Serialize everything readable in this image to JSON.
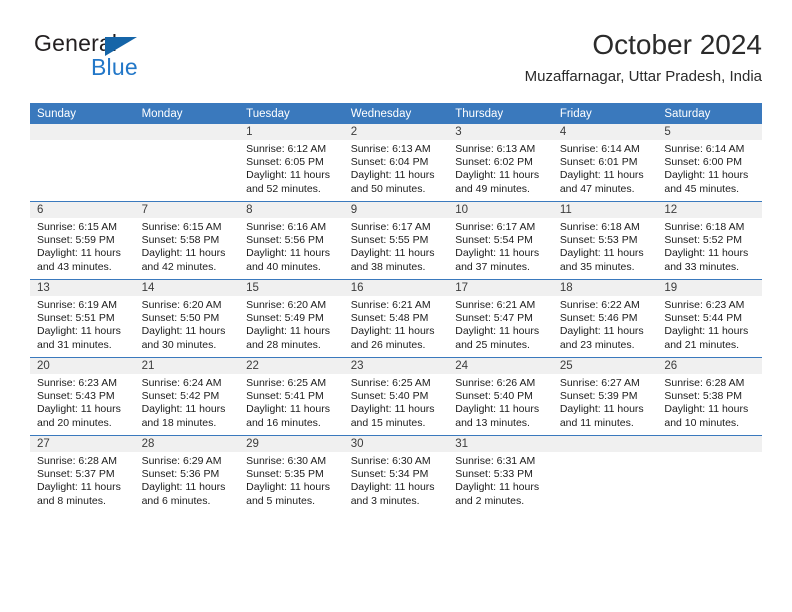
{
  "brand": {
    "name_top": "General",
    "name_bottom": "Blue",
    "triangle_icon": "blue-triangle-icon",
    "accent_color": "#2277c8"
  },
  "header": {
    "title": "October 2024",
    "subtitle": "Muzaffarnagar, Uttar Pradesh, India"
  },
  "theme": {
    "header_row_bg": "#3a79bd",
    "date_band_bg": "#f0f0f0",
    "separator_color": "#3a79bd",
    "text_color": "#1c1c1c"
  },
  "calendar": {
    "weekday_headers": [
      "Sunday",
      "Monday",
      "Tuesday",
      "Wednesday",
      "Thursday",
      "Friday",
      "Saturday"
    ],
    "weeks": [
      [
        {
          "date": "",
          "empty": true,
          "sunrise": "",
          "sunset": "",
          "daylight_line1": "",
          "daylight_line2": ""
        },
        {
          "date": "",
          "empty": true,
          "sunrise": "",
          "sunset": "",
          "daylight_line1": "",
          "daylight_line2": ""
        },
        {
          "date": "1",
          "empty": false,
          "sunrise": "Sunrise: 6:12 AM",
          "sunset": "Sunset: 6:05 PM",
          "daylight_line1": "Daylight: 11 hours",
          "daylight_line2": "and 52 minutes."
        },
        {
          "date": "2",
          "empty": false,
          "sunrise": "Sunrise: 6:13 AM",
          "sunset": "Sunset: 6:04 PM",
          "daylight_line1": "Daylight: 11 hours",
          "daylight_line2": "and 50 minutes."
        },
        {
          "date": "3",
          "empty": false,
          "sunrise": "Sunrise: 6:13 AM",
          "sunset": "Sunset: 6:02 PM",
          "daylight_line1": "Daylight: 11 hours",
          "daylight_line2": "and 49 minutes."
        },
        {
          "date": "4",
          "empty": false,
          "sunrise": "Sunrise: 6:14 AM",
          "sunset": "Sunset: 6:01 PM",
          "daylight_line1": "Daylight: 11 hours",
          "daylight_line2": "and 47 minutes."
        },
        {
          "date": "5",
          "empty": false,
          "sunrise": "Sunrise: 6:14 AM",
          "sunset": "Sunset: 6:00 PM",
          "daylight_line1": "Daylight: 11 hours",
          "daylight_line2": "and 45 minutes."
        }
      ],
      [
        {
          "date": "6",
          "empty": false,
          "sunrise": "Sunrise: 6:15 AM",
          "sunset": "Sunset: 5:59 PM",
          "daylight_line1": "Daylight: 11 hours",
          "daylight_line2": "and 43 minutes."
        },
        {
          "date": "7",
          "empty": false,
          "sunrise": "Sunrise: 6:15 AM",
          "sunset": "Sunset: 5:58 PM",
          "daylight_line1": "Daylight: 11 hours",
          "daylight_line2": "and 42 minutes."
        },
        {
          "date": "8",
          "empty": false,
          "sunrise": "Sunrise: 6:16 AM",
          "sunset": "Sunset: 5:56 PM",
          "daylight_line1": "Daylight: 11 hours",
          "daylight_line2": "and 40 minutes."
        },
        {
          "date": "9",
          "empty": false,
          "sunrise": "Sunrise: 6:17 AM",
          "sunset": "Sunset: 5:55 PM",
          "daylight_line1": "Daylight: 11 hours",
          "daylight_line2": "and 38 minutes."
        },
        {
          "date": "10",
          "empty": false,
          "sunrise": "Sunrise: 6:17 AM",
          "sunset": "Sunset: 5:54 PM",
          "daylight_line1": "Daylight: 11 hours",
          "daylight_line2": "and 37 minutes."
        },
        {
          "date": "11",
          "empty": false,
          "sunrise": "Sunrise: 6:18 AM",
          "sunset": "Sunset: 5:53 PM",
          "daylight_line1": "Daylight: 11 hours",
          "daylight_line2": "and 35 minutes."
        },
        {
          "date": "12",
          "empty": false,
          "sunrise": "Sunrise: 6:18 AM",
          "sunset": "Sunset: 5:52 PM",
          "daylight_line1": "Daylight: 11 hours",
          "daylight_line2": "and 33 minutes."
        }
      ],
      [
        {
          "date": "13",
          "empty": false,
          "sunrise": "Sunrise: 6:19 AM",
          "sunset": "Sunset: 5:51 PM",
          "daylight_line1": "Daylight: 11 hours",
          "daylight_line2": "and 31 minutes."
        },
        {
          "date": "14",
          "empty": false,
          "sunrise": "Sunrise: 6:20 AM",
          "sunset": "Sunset: 5:50 PM",
          "daylight_line1": "Daylight: 11 hours",
          "daylight_line2": "and 30 minutes."
        },
        {
          "date": "15",
          "empty": false,
          "sunrise": "Sunrise: 6:20 AM",
          "sunset": "Sunset: 5:49 PM",
          "daylight_line1": "Daylight: 11 hours",
          "daylight_line2": "and 28 minutes."
        },
        {
          "date": "16",
          "empty": false,
          "sunrise": "Sunrise: 6:21 AM",
          "sunset": "Sunset: 5:48 PM",
          "daylight_line1": "Daylight: 11 hours",
          "daylight_line2": "and 26 minutes."
        },
        {
          "date": "17",
          "empty": false,
          "sunrise": "Sunrise: 6:21 AM",
          "sunset": "Sunset: 5:47 PM",
          "daylight_line1": "Daylight: 11 hours",
          "daylight_line2": "and 25 minutes."
        },
        {
          "date": "18",
          "empty": false,
          "sunrise": "Sunrise: 6:22 AM",
          "sunset": "Sunset: 5:46 PM",
          "daylight_line1": "Daylight: 11 hours",
          "daylight_line2": "and 23 minutes."
        },
        {
          "date": "19",
          "empty": false,
          "sunrise": "Sunrise: 6:23 AM",
          "sunset": "Sunset: 5:44 PM",
          "daylight_line1": "Daylight: 11 hours",
          "daylight_line2": "and 21 minutes."
        }
      ],
      [
        {
          "date": "20",
          "empty": false,
          "sunrise": "Sunrise: 6:23 AM",
          "sunset": "Sunset: 5:43 PM",
          "daylight_line1": "Daylight: 11 hours",
          "daylight_line2": "and 20 minutes."
        },
        {
          "date": "21",
          "empty": false,
          "sunrise": "Sunrise: 6:24 AM",
          "sunset": "Sunset: 5:42 PM",
          "daylight_line1": "Daylight: 11 hours",
          "daylight_line2": "and 18 minutes."
        },
        {
          "date": "22",
          "empty": false,
          "sunrise": "Sunrise: 6:25 AM",
          "sunset": "Sunset: 5:41 PM",
          "daylight_line1": "Daylight: 11 hours",
          "daylight_line2": "and 16 minutes."
        },
        {
          "date": "23",
          "empty": false,
          "sunrise": "Sunrise: 6:25 AM",
          "sunset": "Sunset: 5:40 PM",
          "daylight_line1": "Daylight: 11 hours",
          "daylight_line2": "and 15 minutes."
        },
        {
          "date": "24",
          "empty": false,
          "sunrise": "Sunrise: 6:26 AM",
          "sunset": "Sunset: 5:40 PM",
          "daylight_line1": "Daylight: 11 hours",
          "daylight_line2": "and 13 minutes."
        },
        {
          "date": "25",
          "empty": false,
          "sunrise": "Sunrise: 6:27 AM",
          "sunset": "Sunset: 5:39 PM",
          "daylight_line1": "Daylight: 11 hours",
          "daylight_line2": "and 11 minutes."
        },
        {
          "date": "26",
          "empty": false,
          "sunrise": "Sunrise: 6:28 AM",
          "sunset": "Sunset: 5:38 PM",
          "daylight_line1": "Daylight: 11 hours",
          "daylight_line2": "and 10 minutes."
        }
      ],
      [
        {
          "date": "27",
          "empty": false,
          "sunrise": "Sunrise: 6:28 AM",
          "sunset": "Sunset: 5:37 PM",
          "daylight_line1": "Daylight: 11 hours",
          "daylight_line2": "and 8 minutes."
        },
        {
          "date": "28",
          "empty": false,
          "sunrise": "Sunrise: 6:29 AM",
          "sunset": "Sunset: 5:36 PM",
          "daylight_line1": "Daylight: 11 hours",
          "daylight_line2": "and 6 minutes."
        },
        {
          "date": "29",
          "empty": false,
          "sunrise": "Sunrise: 6:30 AM",
          "sunset": "Sunset: 5:35 PM",
          "daylight_line1": "Daylight: 11 hours",
          "daylight_line2": "and 5 minutes."
        },
        {
          "date": "30",
          "empty": false,
          "sunrise": "Sunrise: 6:30 AM",
          "sunset": "Sunset: 5:34 PM",
          "daylight_line1": "Daylight: 11 hours",
          "daylight_line2": "and 3 minutes."
        },
        {
          "date": "31",
          "empty": false,
          "sunrise": "Sunrise: 6:31 AM",
          "sunset": "Sunset: 5:33 PM",
          "daylight_line1": "Daylight: 11 hours",
          "daylight_line2": "and 2 minutes."
        },
        {
          "date": "",
          "empty": true,
          "sunrise": "",
          "sunset": "",
          "daylight_line1": "",
          "daylight_line2": ""
        },
        {
          "date": "",
          "empty": true,
          "sunrise": "",
          "sunset": "",
          "daylight_line1": "",
          "daylight_line2": ""
        }
      ]
    ]
  }
}
